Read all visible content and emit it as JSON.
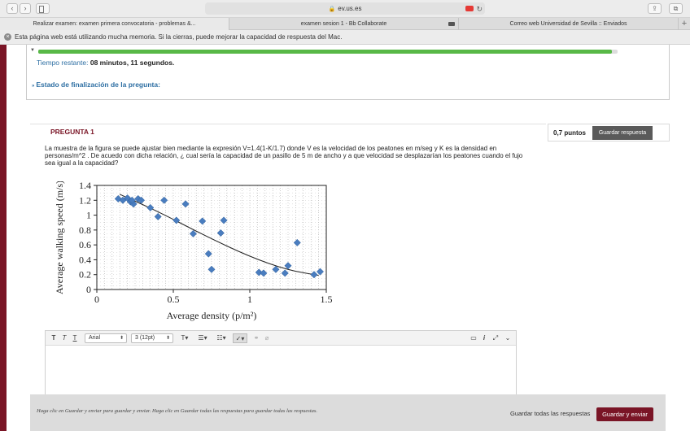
{
  "browser": {
    "url": "ev.us.es",
    "tabs": [
      {
        "label": "Realizar examen: examen primera convocatoria - problemas &...",
        "active": true
      },
      {
        "label": "examen sesion 1 - Bb Collaborate",
        "active": false,
        "media": true
      },
      {
        "label": "Correo web Universidad de Sevilla :: Enviados",
        "active": false
      }
    ],
    "memory_warning": "Esta página web está utilizando mucha memoria. Si la cierras, puede mejorar la capacidad de respuesta del Mac."
  },
  "timer": {
    "label": "Tiempo restante:",
    "value": "08 minutos, 11 segundos.",
    "progress": 0.99,
    "status_link": "Estado de finalización de la pregunta:"
  },
  "question": {
    "title": "PREGUNTA 1",
    "points": "0,7 puntos",
    "save_label": "Guardar respuesta",
    "text": "La muestra de la figura se puede ajustar bien mediante la expresión V=1.4(1-K/1.7) donde V es la velocidad de los peatones en m/seg y K es la densidad en personas/m^2 . De acuedo con dicha relación, ¿ cual sería la capacidad de un pasillo de 5 m de ancho y a que velocidad se desplazarían los peatones cuando el fujo sea igual a la capacidad?"
  },
  "chart_data": {
    "type": "scatter",
    "xlabel": "Average density (p/m²)",
    "ylabel": "Average walking speed (m/s)",
    "xlim": [
      0,
      1.5
    ],
    "ylim": [
      0,
      1.4
    ],
    "xticks": [
      "0",
      "0.5",
      "1",
      "1.5"
    ],
    "yticks": [
      "0",
      "0.2",
      "0.4",
      "0.6",
      "0.8",
      "1",
      "1.2",
      "1.4"
    ],
    "points": [
      [
        0.14,
        1.22
      ],
      [
        0.17,
        1.2
      ],
      [
        0.2,
        1.23
      ],
      [
        0.22,
        1.18
      ],
      [
        0.24,
        1.15
      ],
      [
        0.23,
        1.2
      ],
      [
        0.27,
        1.22
      ],
      [
        0.29,
        1.2
      ],
      [
        0.35,
        1.1
      ],
      [
        0.4,
        0.98
      ],
      [
        0.44,
        1.2
      ],
      [
        0.52,
        0.93
      ],
      [
        0.58,
        1.15
      ],
      [
        0.63,
        0.75
      ],
      [
        0.69,
        0.92
      ],
      [
        0.73,
        0.48
      ],
      [
        0.75,
        0.27
      ],
      [
        0.81,
        0.76
      ],
      [
        0.83,
        0.93
      ],
      [
        1.06,
        0.23
      ],
      [
        1.09,
        0.22
      ],
      [
        1.17,
        0.27
      ],
      [
        1.23,
        0.22
      ],
      [
        1.25,
        0.32
      ],
      [
        1.31,
        0.63
      ],
      [
        1.42,
        0.2
      ],
      [
        1.46,
        0.24
      ]
    ],
    "trendline": [
      [
        0.15,
        1.28
      ],
      [
        0.4,
        1.05
      ],
      [
        0.7,
        0.73
      ],
      [
        1.0,
        0.44
      ],
      [
        1.25,
        0.26
      ],
      [
        1.45,
        0.19
      ]
    ],
    "grid": true,
    "marker_color": "#4a7dbf"
  },
  "editor": {
    "font": "Arial",
    "size": "3 (12pt)"
  },
  "footer": {
    "hint": "Haga clic en Guardar y enviar para guardar y enviar. Haga clic en Guardar todas las respuestas para guardar todas las respuestas.",
    "save_all": "Guardar todas las respuestas",
    "submit": "Guardar y enviar"
  },
  "colors": {
    "accent": "#7a1526",
    "link": "#2e6fa3",
    "progress": "#58b847"
  }
}
